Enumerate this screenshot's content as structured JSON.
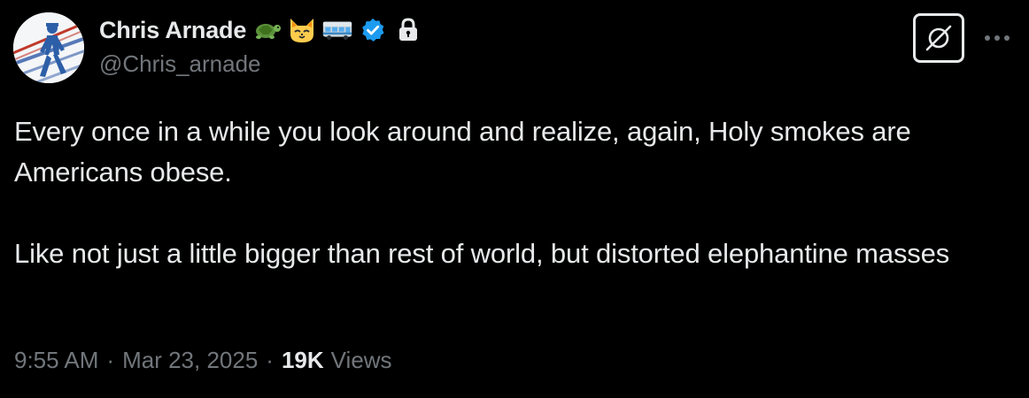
{
  "author": {
    "display_name": "Chris Arnade",
    "handle": "@Chris_arnade",
    "badges": [
      "turtle-emoji",
      "cat-emoji",
      "bus-emoji",
      "verified-badge-icon",
      "lock-icon"
    ],
    "verified_color": "#1d9bf0"
  },
  "tweet": {
    "paragraphs": [
      "Every once in a while you look around and realize, again, Holy smokes are Americans obese.",
      "Like not just a little bigger than rest of world, but distorted elephantine masses"
    ]
  },
  "meta": {
    "time": "9:55 AM",
    "separator": "·",
    "date": "Mar 23, 2025",
    "views_count": "19K",
    "views_label": "Views"
  },
  "actions": {
    "grok_icon": "grok-icon",
    "more_icon": "more-options-icon"
  },
  "colors": {
    "background": "#000000",
    "text_primary": "#e7e9ea",
    "text_secondary": "#71767b"
  }
}
